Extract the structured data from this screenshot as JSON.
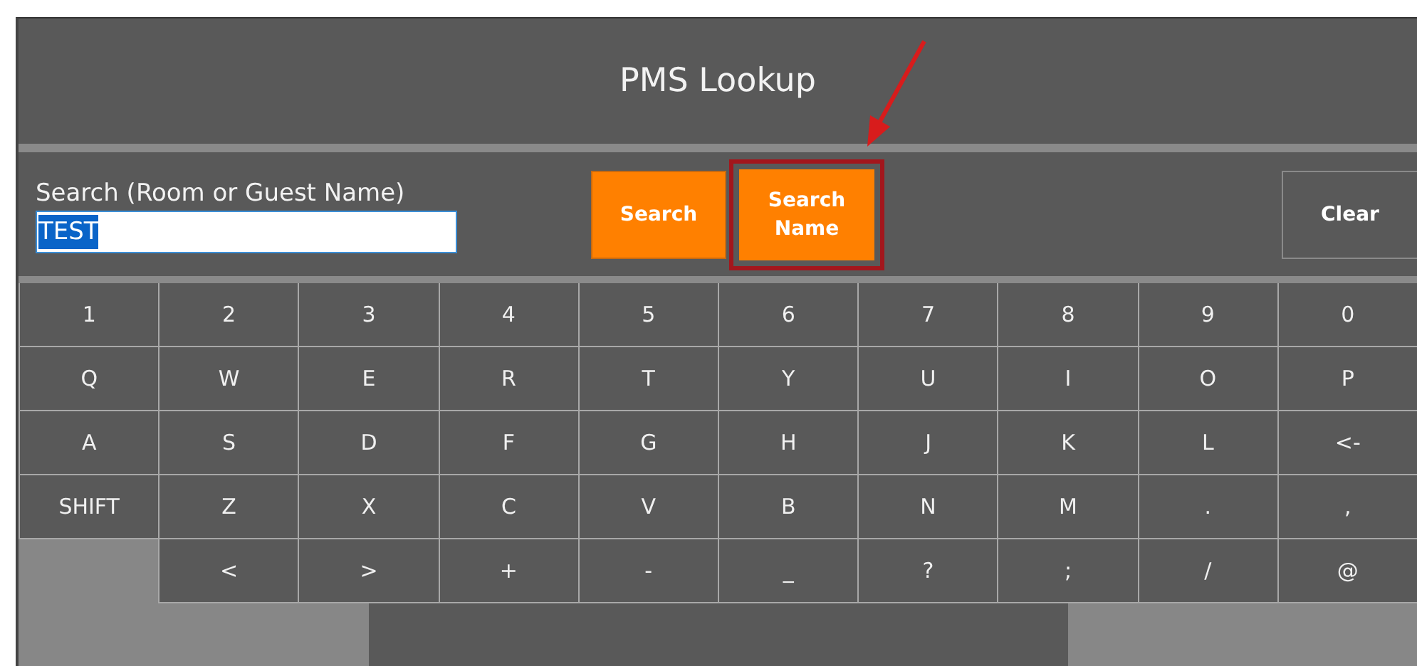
{
  "window": {
    "title": "PMS Lookup"
  },
  "search": {
    "label": "Search (Room or Guest Name)",
    "value": "TEST",
    "text_selected": true
  },
  "buttons": [
    {
      "label": "Search",
      "kind": "primary",
      "annotated": false
    },
    {
      "label": "Search Name",
      "kind": "primary",
      "annotated": true
    },
    {
      "label": "Clear",
      "kind": "outline",
      "annotated": false
    }
  ],
  "keyboard": {
    "rows": [
      [
        "1",
        "2",
        "3",
        "4",
        "5",
        "6",
        "7",
        "8",
        "9",
        "0"
      ],
      [
        "Q",
        "W",
        "E",
        "R",
        "T",
        "Y",
        "U",
        "I",
        "O",
        "P"
      ],
      [
        "A",
        "S",
        "D",
        "F",
        "G",
        "H",
        "J",
        "K",
        "L",
        "<-"
      ],
      [
        "SHIFT",
        "Z",
        "X",
        "C",
        "V",
        "B",
        "N",
        "M",
        ".",
        ","
      ],
      [
        "",
        "<",
        ">",
        "+",
        "-",
        "_",
        "?",
        ";",
        "/",
        "@"
      ]
    ],
    "space_bar": true
  }
}
